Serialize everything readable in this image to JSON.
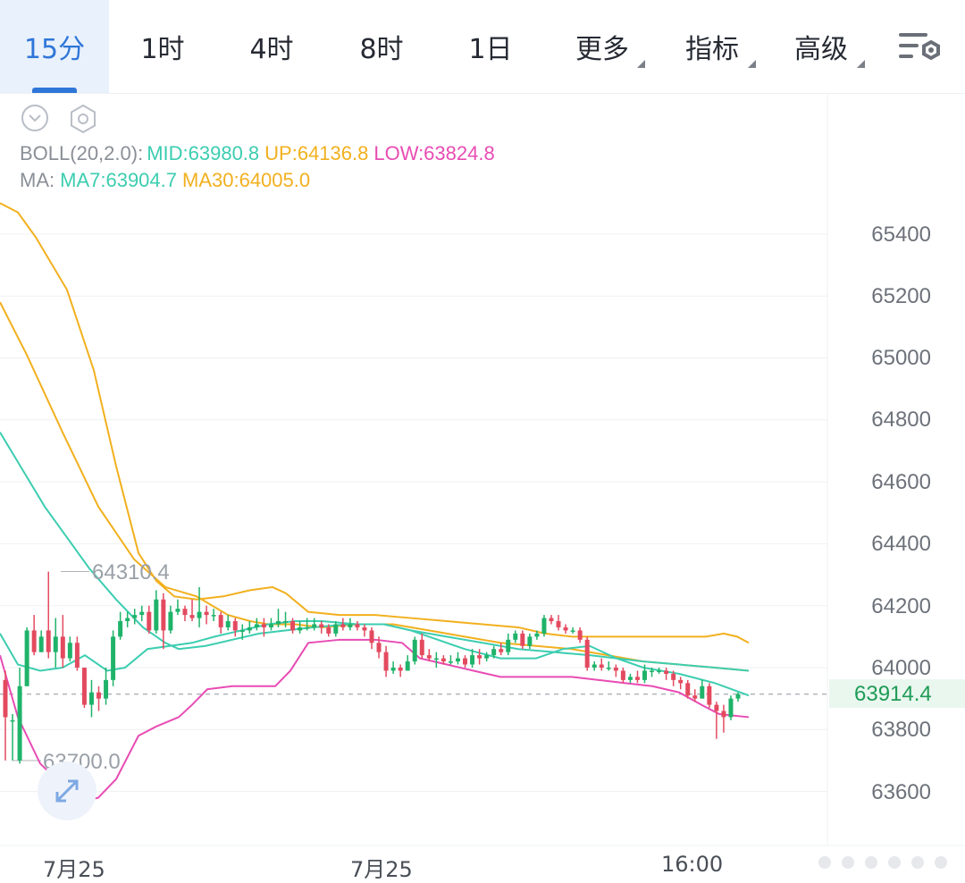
{
  "tabs": [
    {
      "label": "15分",
      "active": true
    },
    {
      "label": "1时"
    },
    {
      "label": "4时"
    },
    {
      "label": "8时"
    },
    {
      "label": "1日"
    },
    {
      "label": "更多",
      "dropdown": true
    },
    {
      "label": "指标",
      "dropdown": true
    },
    {
      "label": "高级",
      "dropdown": true
    }
  ],
  "settings_icon": "chart-settings-icon",
  "legend": {
    "boll_prefix": "BOLL(20,2.0):",
    "boll_mid": "MID:63980.8",
    "boll_up": "UP:64136.8",
    "boll_low": "LOW:63824.8",
    "ma_prefix": "MA:",
    "ma7": "MA7:63904.7",
    "ma30": "MA30:64005.0"
  },
  "colors": {
    "up": "#1fb36a",
    "down": "#e34a5f",
    "mid": "#3ccdb0",
    "upper": "#f2b01e",
    "lower": "#e84cb4",
    "ma7": "#3ccdb0",
    "ma30": "#f2b01e",
    "grid": "#eef0f3",
    "accent": "#2f76d8"
  },
  "chart_data": {
    "type": "candlestick",
    "y_axis_labels": [
      "65400",
      "65200",
      "65000",
      "64800",
      "64600",
      "64400",
      "64200",
      "64000",
      "63800",
      "63600"
    ],
    "x_axis_labels": [
      "7月25",
      "7月25",
      "16:00"
    ],
    "current_price": "63914.4",
    "max_annotation": "64310.4",
    "min_annotation": "63700.0",
    "ylim": [
      63520,
      65560
    ],
    "candles": [
      [
        63960,
        63840,
        63990,
        63700
      ],
      [
        63830,
        63830,
        63850,
        63700
      ],
      [
        63700,
        63940,
        64000,
        63690
      ],
      [
        63940,
        64120,
        64130,
        63940
      ],
      [
        64120,
        64050,
        64170,
        64040
      ],
      [
        64050,
        64100,
        64120,
        64050
      ],
      [
        64120,
        64050,
        64310,
        64030
      ],
      [
        64050,
        64100,
        64160,
        64000
      ],
      [
        64100,
        64030,
        64170,
        64000
      ],
      [
        64030,
        64080,
        64100,
        64020
      ],
      [
        64080,
        64000,
        64100,
        63990
      ],
      [
        64000,
        63880,
        64000,
        63870
      ],
      [
        63880,
        63920,
        63960,
        63840
      ],
      [
        63920,
        63900,
        63940,
        63860
      ],
      [
        63900,
        63960,
        64000,
        63880
      ],
      [
        63960,
        64100,
        64120,
        63940
      ],
      [
        64100,
        64150,
        64180,
        64090
      ],
      [
        64150,
        64160,
        64180,
        64130
      ],
      [
        64160,
        64170,
        64190,
        64140
      ],
      [
        64170,
        64180,
        64200,
        64150
      ],
      [
        64180,
        64120,
        64200,
        64110
      ],
      [
        64120,
        64220,
        64250,
        64110
      ],
      [
        64220,
        64120,
        64240,
        64060
      ],
      [
        64120,
        64180,
        64200,
        64110
      ],
      [
        64180,
        64190,
        64220,
        64170
      ],
      [
        64190,
        64170,
        64200,
        64150
      ],
      [
        64170,
        64160,
        64220,
        64150
      ],
      [
        64160,
        64180,
        64260,
        64130
      ],
      [
        64180,
        64170,
        64200,
        64140
      ],
      [
        64170,
        64170,
        64190,
        64150
      ],
      [
        64170,
        64130,
        64180,
        64110
      ],
      [
        64130,
        64150,
        64170,
        64120
      ],
      [
        64150,
        64120,
        64160,
        64100
      ],
      [
        64120,
        64120,
        64140,
        64090
      ],
      [
        64120,
        64130,
        64150,
        64110
      ],
      [
        64130,
        64140,
        64160,
        64120
      ],
      [
        64140,
        64130,
        64160,
        64100
      ],
      [
        64130,
        64140,
        64160,
        64120
      ],
      [
        64140,
        64150,
        64190,
        64130
      ],
      [
        64150,
        64150,
        64180,
        64130
      ],
      [
        64150,
        64120,
        64160,
        64110
      ],
      [
        64120,
        64130,
        64150,
        64110
      ],
      [
        64130,
        64130,
        64160,
        64120
      ],
      [
        64130,
        64140,
        64160,
        64120
      ],
      [
        64140,
        64130,
        64150,
        64110
      ],
      [
        64130,
        64110,
        64140,
        64100
      ],
      [
        64110,
        64140,
        64150,
        64100
      ],
      [
        64140,
        64130,
        64160,
        64120
      ],
      [
        64130,
        64140,
        64160,
        64120
      ],
      [
        64140,
        64130,
        64150,
        64120
      ],
      [
        64130,
        64120,
        64140,
        64100
      ],
      [
        64120,
        64080,
        64130,
        64060
      ],
      [
        64080,
        64050,
        64100,
        64030
      ],
      [
        64050,
        63990,
        64070,
        63970
      ],
      [
        63990,
        64000,
        64020,
        63980
      ],
      [
        64000,
        63990,
        64010,
        63970
      ],
      [
        63990,
        64020,
        64040,
        63990
      ],
      [
        64020,
        64090,
        64100,
        64010
      ],
      [
        64090,
        64040,
        64110,
        64030
      ],
      [
        64040,
        64030,
        64060,
        64020
      ],
      [
        64030,
        64030,
        64050,
        64000
      ],
      [
        64030,
        64020,
        64040,
        64010
      ],
      [
        64020,
        64020,
        64040,
        64010
      ],
      [
        64020,
        64030,
        64050,
        64010
      ],
      [
        64030,
        64010,
        64040,
        64000
      ],
      [
        64010,
        64040,
        64060,
        64000
      ],
      [
        64040,
        64030,
        64060,
        64010
      ],
      [
        64030,
        64040,
        64050,
        64020
      ],
      [
        64040,
        64060,
        64070,
        64030
      ],
      [
        64060,
        64050,
        64080,
        64040
      ],
      [
        64050,
        64090,
        64110,
        64040
      ],
      [
        64090,
        64110,
        64120,
        64080
      ],
      [
        64110,
        64070,
        64120,
        64060
      ],
      [
        64070,
        64100,
        64110,
        64060
      ],
      [
        64100,
        64110,
        64120,
        64090
      ],
      [
        64110,
        64160,
        64170,
        64100
      ],
      [
        64160,
        64150,
        64170,
        64140
      ],
      [
        64150,
        64130,
        64170,
        64120
      ],
      [
        64130,
        64120,
        64140,
        64110
      ],
      [
        64120,
        64120,
        64130,
        64110
      ],
      [
        64120,
        64090,
        64130,
        64080
      ],
      [
        64090,
        64000,
        64100,
        63990
      ],
      [
        64000,
        64010,
        64020,
        63990
      ],
      [
        64010,
        64000,
        64030,
        63990
      ],
      [
        64000,
        64000,
        64020,
        63990
      ],
      [
        64000,
        63990,
        64010,
        63970
      ],
      [
        63990,
        63960,
        64000,
        63950
      ],
      [
        63960,
        63970,
        63980,
        63950
      ],
      [
        63970,
        63960,
        63990,
        63950
      ],
      [
        63960,
        63990,
        64010,
        63950
      ],
      [
        63990,
        63990,
        64000,
        63970
      ],
      [
        63990,
        63990,
        64000,
        63980
      ],
      [
        63990,
        63980,
        64000,
        63960
      ],
      [
        63980,
        63960,
        63990,
        63940
      ],
      [
        63960,
        63950,
        63970,
        63930
      ],
      [
        63950,
        63910,
        63960,
        63900
      ],
      [
        63910,
        63900,
        63930,
        63890
      ],
      [
        63900,
        63940,
        63960,
        63900
      ],
      [
        63940,
        63880,
        63950,
        63870
      ],
      [
        63880,
        63860,
        63890,
        63770
      ],
      [
        63860,
        63840,
        63880,
        63790
      ],
      [
        63840,
        63900,
        63910,
        63830
      ],
      [
        63900,
        63914.4,
        63920,
        63890
      ]
    ],
    "boll_upper": [
      [
        0,
        65500
      ],
      [
        20,
        65470
      ],
      [
        40,
        65390
      ],
      [
        75,
        65220
      ],
      [
        105,
        64960
      ],
      [
        130,
        64650
      ],
      [
        155,
        64370
      ],
      [
        175,
        64280
      ],
      [
        195,
        64230
      ],
      [
        220,
        64220
      ],
      [
        250,
        64230
      ],
      [
        280,
        64250
      ],
      [
        305,
        64260
      ],
      [
        320,
        64240
      ],
      [
        345,
        64180
      ],
      [
        380,
        64170
      ],
      [
        420,
        64170
      ],
      [
        460,
        64160
      ],
      [
        500,
        64150
      ],
      [
        540,
        64140
      ],
      [
        580,
        64130
      ],
      [
        610,
        64110
      ],
      [
        640,
        64100
      ],
      [
        680,
        64100
      ],
      [
        720,
        64100
      ],
      [
        760,
        64100
      ],
      [
        790,
        64100
      ],
      [
        810,
        64110
      ],
      [
        825,
        64100
      ],
      [
        838,
        64080
      ]
    ],
    "boll_mid": [
      [
        0,
        64760
      ],
      [
        25,
        64640
      ],
      [
        50,
        64520
      ],
      [
        75,
        64420
      ],
      [
        100,
        64320
      ],
      [
        130,
        64220
      ],
      [
        160,
        64130
      ],
      [
        185,
        64080
      ],
      [
        200,
        64060
      ],
      [
        230,
        64070
      ],
      [
        260,
        64090
      ],
      [
        290,
        64110
      ],
      [
        320,
        64120
      ],
      [
        350,
        64130
      ],
      [
        390,
        64140
      ],
      [
        430,
        64140
      ],
      [
        460,
        64120
      ],
      [
        500,
        64100
      ],
      [
        540,
        64080
      ],
      [
        580,
        64060
      ],
      [
        620,
        64050
      ],
      [
        660,
        64040
      ],
      [
        690,
        64030
      ],
      [
        720,
        64020
      ],
      [
        760,
        64010
      ],
      [
        800,
        64000
      ],
      [
        838,
        63990
      ]
    ],
    "boll_lower": [
      [
        0,
        64040
      ],
      [
        20,
        63840
      ],
      [
        45,
        63690
      ],
      [
        70,
        63620
      ],
      [
        95,
        63570
      ],
      [
        110,
        63580
      ],
      [
        130,
        63640
      ],
      [
        155,
        63780
      ],
      [
        175,
        63810
      ],
      [
        200,
        63840
      ],
      [
        215,
        63880
      ],
      [
        232,
        63930
      ],
      [
        260,
        63940
      ],
      [
        290,
        63940
      ],
      [
        308,
        63940
      ],
      [
        325,
        63990
      ],
      [
        345,
        64080
      ],
      [
        380,
        64090
      ],
      [
        420,
        64090
      ],
      [
        450,
        64080
      ],
      [
        470,
        64030
      ],
      [
        500,
        64010
      ],
      [
        530,
        63990
      ],
      [
        560,
        63970
      ],
      [
        600,
        63970
      ],
      [
        640,
        63970
      ],
      [
        670,
        63960
      ],
      [
        700,
        63950
      ],
      [
        730,
        63940
      ],
      [
        760,
        63920
      ],
      [
        785,
        63880
      ],
      [
        805,
        63850
      ],
      [
        838,
        63840
      ]
    ],
    "ma7": [
      [
        0,
        64110
      ],
      [
        20,
        64010
      ],
      [
        45,
        63990
      ],
      [
        70,
        64000
      ],
      [
        95,
        64040
      ],
      [
        120,
        63990
      ],
      [
        140,
        64000
      ],
      [
        165,
        64060
      ],
      [
        190,
        64070
      ],
      [
        215,
        64080
      ],
      [
        240,
        64100
      ],
      [
        270,
        64120
      ],
      [
        300,
        64140
      ],
      [
        330,
        64150
      ],
      [
        360,
        64150
      ],
      [
        400,
        64140
      ],
      [
        430,
        64140
      ],
      [
        460,
        64120
      ],
      [
        490,
        64090
      ],
      [
        520,
        64060
      ],
      [
        560,
        64030
      ],
      [
        600,
        64030
      ],
      [
        630,
        64060
      ],
      [
        660,
        64070
      ],
      [
        690,
        64030
      ],
      [
        720,
        64000
      ],
      [
        760,
        63980
      ],
      [
        800,
        63950
      ],
      [
        838,
        63910
      ]
    ],
    "ma30": [
      [
        0,
        65180
      ],
      [
        30,
        65010
      ],
      [
        70,
        64760
      ],
      [
        110,
        64520
      ],
      [
        150,
        64350
      ],
      [
        185,
        64260
      ],
      [
        220,
        64230
      ],
      [
        255,
        64170
      ],
      [
        280,
        64150
      ],
      [
        300,
        64140
      ],
      [
        330,
        64140
      ],
      [
        360,
        64130
      ],
      [
        400,
        64140
      ],
      [
        440,
        64140
      ],
      [
        480,
        64120
      ],
      [
        520,
        64100
      ],
      [
        560,
        64080
      ],
      [
        600,
        64070
      ],
      [
        640,
        64060
      ],
      [
        680,
        64040
      ],
      [
        720,
        64020
      ],
      [
        760,
        64010
      ],
      [
        800,
        64000
      ],
      [
        838,
        63990
      ]
    ]
  }
}
